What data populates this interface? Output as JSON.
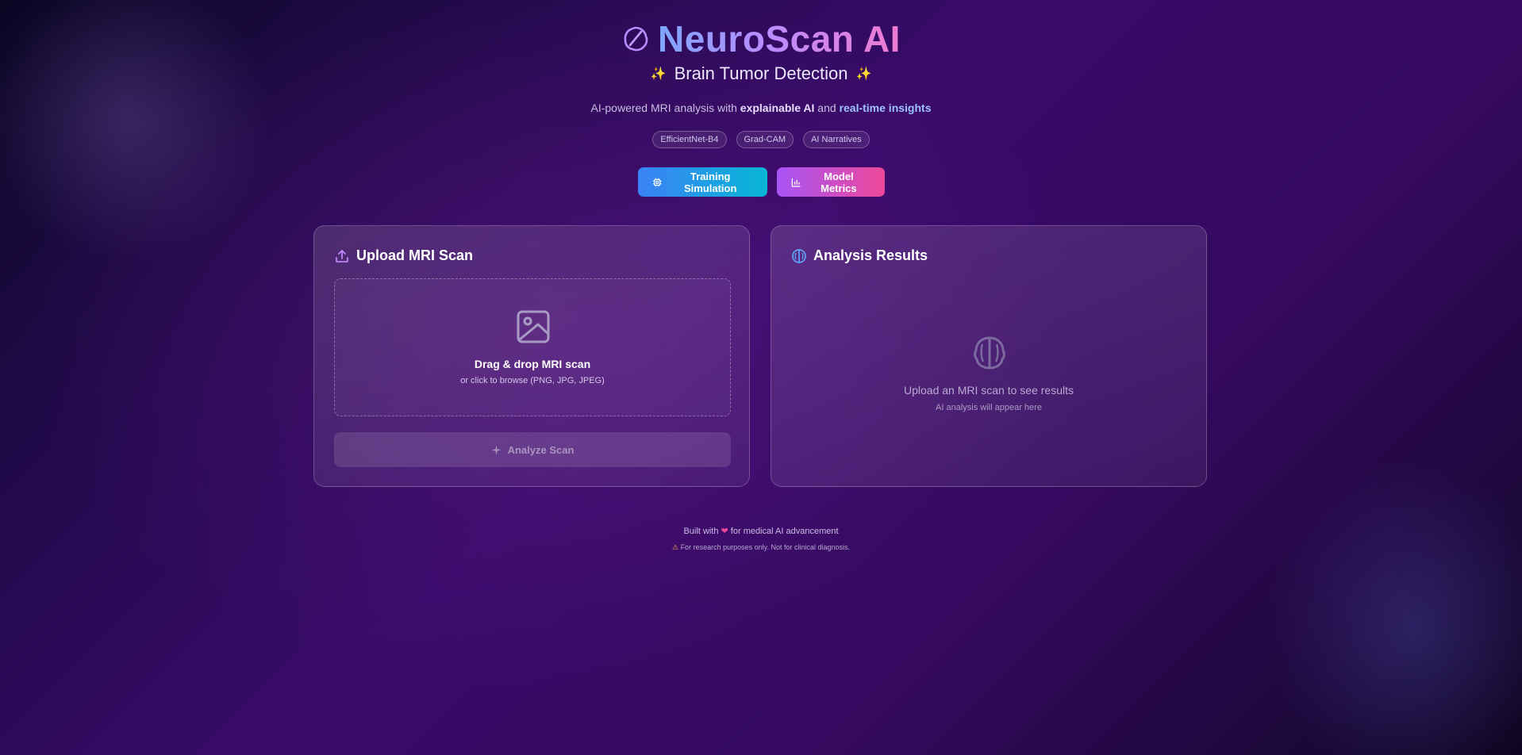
{
  "header": {
    "title": "NeuroScan AI",
    "subtitle": "Brain Tumor Detection",
    "sparkle_left": "✨",
    "sparkle_right": "✨",
    "tagline_prefix": "AI-powered MRI analysis with ",
    "tagline_highlight1": "explainable AI",
    "tagline_mid": " and ",
    "tagline_highlight2": "real-time insights",
    "chips": [
      "EfficientNet-B4",
      "Grad-CAM",
      "AI Narratives"
    ]
  },
  "actions": {
    "training_label": "Training Simulation",
    "metrics_label": "Model Metrics"
  },
  "upload": {
    "title": "Upload MRI Scan",
    "drop_title": "Drag & drop MRI scan",
    "drop_subtitle": "or click to browse (PNG, JPG, JPEG)",
    "analyze_label": "Analyze Scan"
  },
  "results": {
    "title": "Analysis Results",
    "empty_title": "Upload an MRI scan to see results",
    "empty_subtitle": "AI analysis will appear here"
  },
  "footer": {
    "built_prefix": "Built with ",
    "heart": "❤",
    "built_suffix": " for medical AI advancement",
    "warning_icon": "⚠",
    "disclaimer": " For research purposes only. Not for clinical diagnosis."
  },
  "colors": {
    "title_gradient": [
      "#7ea7ff",
      "#b98cff",
      "#f07ad0"
    ],
    "training_gradient": [
      "#3b82f6",
      "#06b6d4"
    ],
    "metrics_gradient": [
      "#a855f7",
      "#ec4899"
    ],
    "accent_purple": "#c084fc",
    "accent_blue": "#60a5fa"
  },
  "icons": {
    "title": "brain-outline-icon",
    "training": "cpu-icon",
    "metrics": "bar-chart-icon",
    "upload": "upload-icon",
    "results": "brain-icon",
    "dropzone": "image-icon",
    "analyze": "sparkle-icon",
    "empty": "brain-icon"
  }
}
